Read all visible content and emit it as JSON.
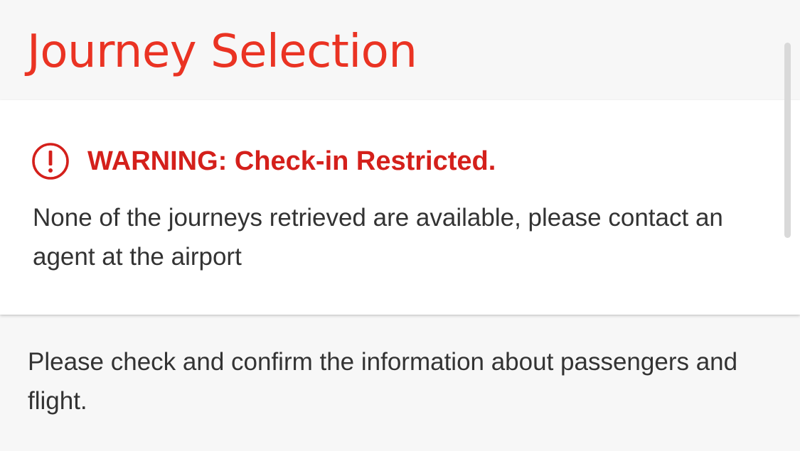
{
  "page": {
    "title": "Journey Selection"
  },
  "warning": {
    "icon": "alert-circle-icon",
    "title": "WARNING: Check-in Restricted.",
    "message": "None of the journeys retrieved are available, please contact an agent at the airport"
  },
  "info": {
    "text": "Please check and confirm the information about passengers and flight."
  },
  "colors": {
    "accent": "#ea3323",
    "warning": "#d4201b",
    "text": "#333333",
    "background": "#f7f7f7",
    "card": "#ffffff"
  }
}
